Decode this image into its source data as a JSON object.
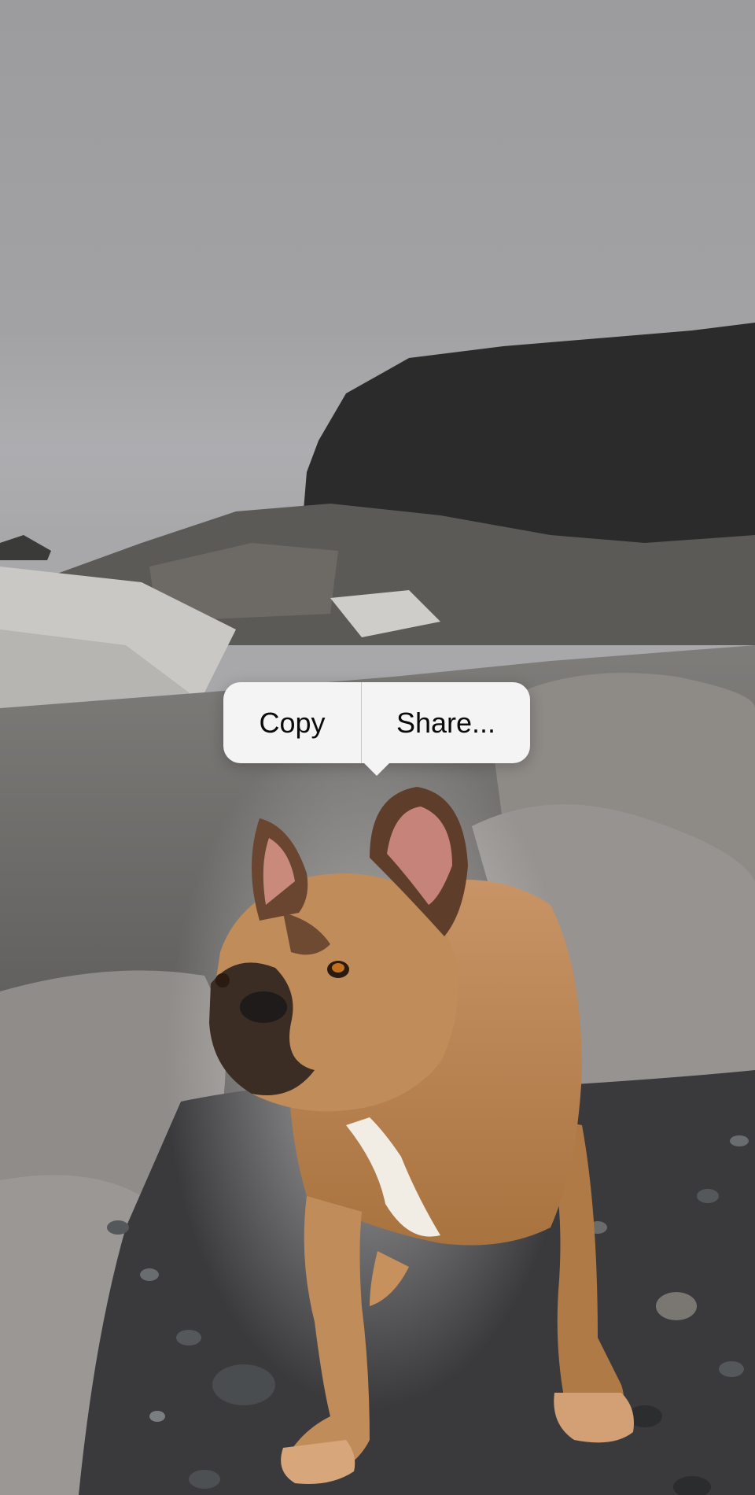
{
  "context_menu": {
    "items": [
      {
        "label": "Copy"
      },
      {
        "label": "Share..."
      }
    ]
  },
  "photo": {
    "subject": "french-bulldog",
    "colors": {
      "sky": "#9c9c9e",
      "rock_dark": "#2a2a2a",
      "rock_light": "#8e8a86",
      "dog_fur": "#b9855a",
      "pebbles": "#3a3a3c"
    }
  }
}
